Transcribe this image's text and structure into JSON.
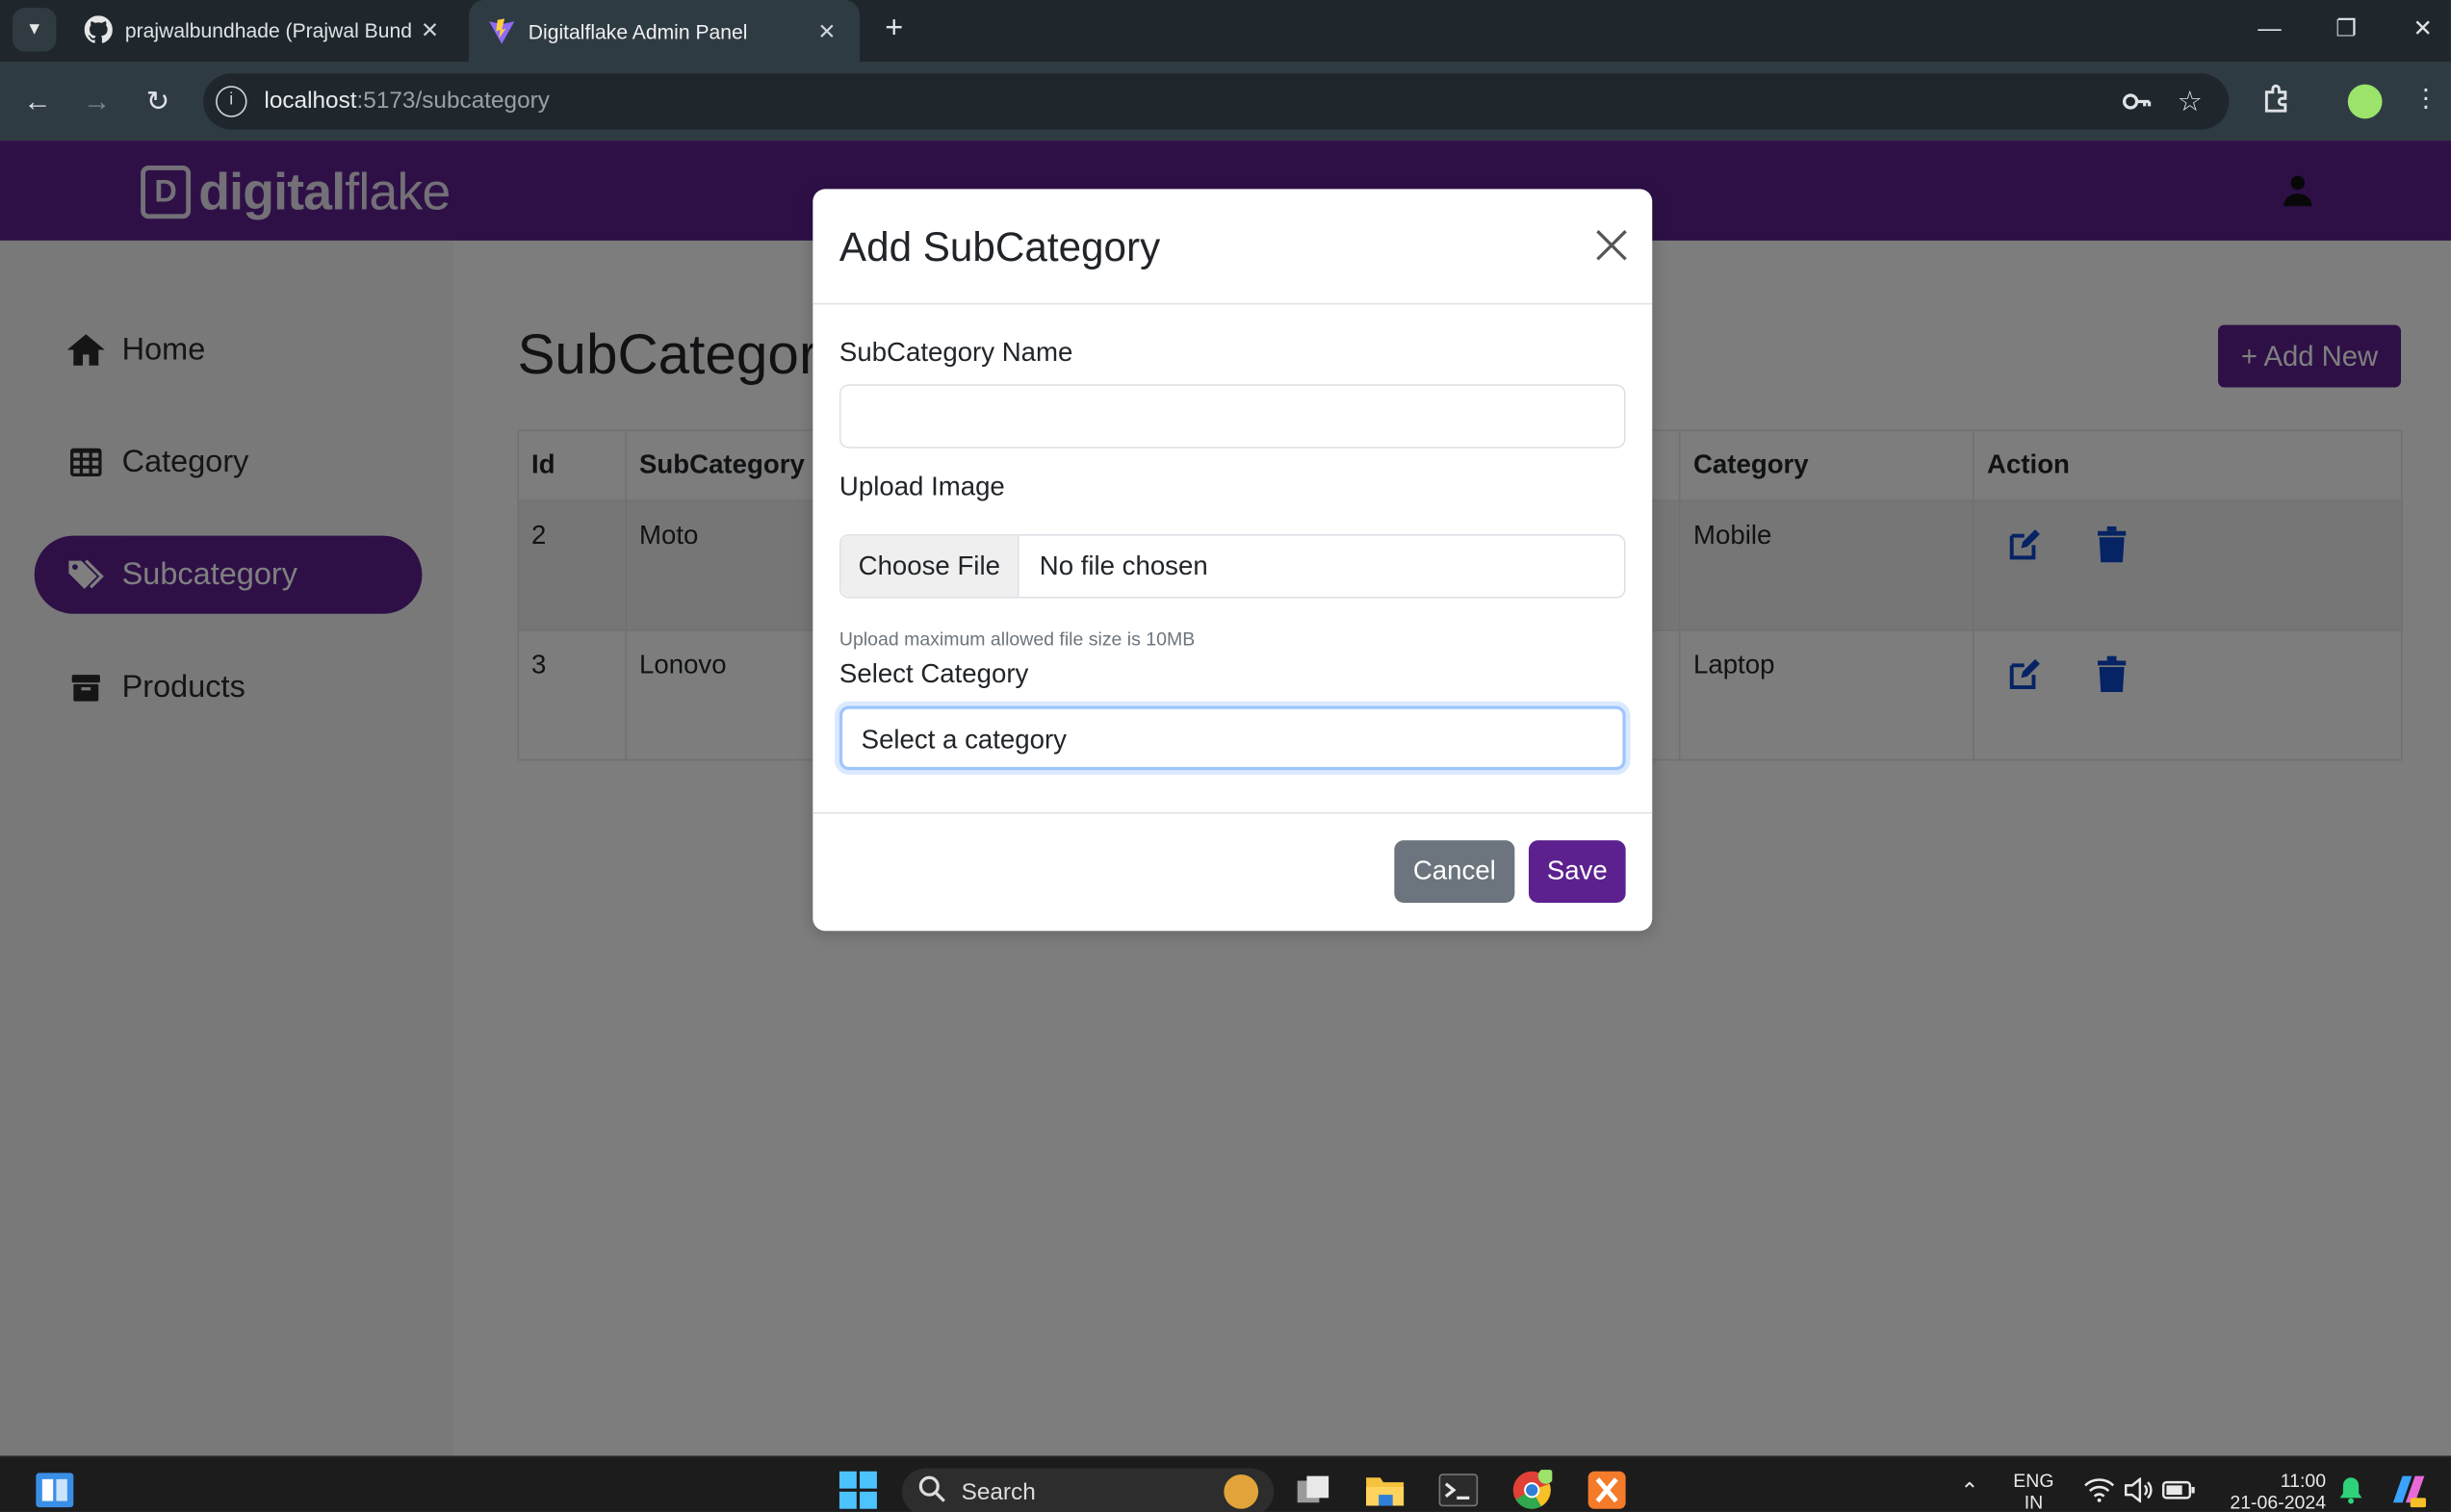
{
  "browser": {
    "tabs": [
      {
        "title": "prajwalbundhade (Prajwal Bund",
        "active": false
      },
      {
        "title": "Digitalflake Admin Panel",
        "active": true
      }
    ],
    "url_host": "localhost",
    "url_rest": ":5173/subcategory"
  },
  "app": {
    "logo": {
      "bold": "digital",
      "light": "flake"
    },
    "sidebar": {
      "items": [
        {
          "label": "Home",
          "icon": "home-icon"
        },
        {
          "label": "Category",
          "icon": "table-icon"
        },
        {
          "label": "Subcategory",
          "icon": "tags-icon",
          "active": true
        },
        {
          "label": "Products",
          "icon": "box-icon"
        }
      ]
    },
    "page_title": "SubCategory",
    "add_new_label": "+ Add New",
    "table": {
      "headers": [
        "Id",
        "SubCategory",
        "Category",
        "Action"
      ],
      "rows": [
        {
          "id": "2",
          "subcategory": "Moto",
          "category": "Mobile"
        },
        {
          "id": "3",
          "subcategory": "Lonovo",
          "category": "Laptop"
        }
      ]
    }
  },
  "modal": {
    "title": "Add SubCategory",
    "name_label": "SubCategory Name",
    "name_value": "",
    "upload_label": "Upload Image",
    "file_button": "Choose File",
    "file_status": "No file chosen",
    "file_hint": "Upload maximum allowed file size is 10MB",
    "category_label": "Select Category",
    "category_selected": "Select a category",
    "cancel_label": "Cancel",
    "save_label": "Save"
  },
  "taskbar": {
    "search_label": "Search",
    "lang_top": "ENG",
    "lang_bottom": "IN",
    "time": "11:00",
    "date": "21-06-2024"
  },
  "colors": {
    "brand": "#5c218f",
    "action_blue": "#0d47c9"
  }
}
